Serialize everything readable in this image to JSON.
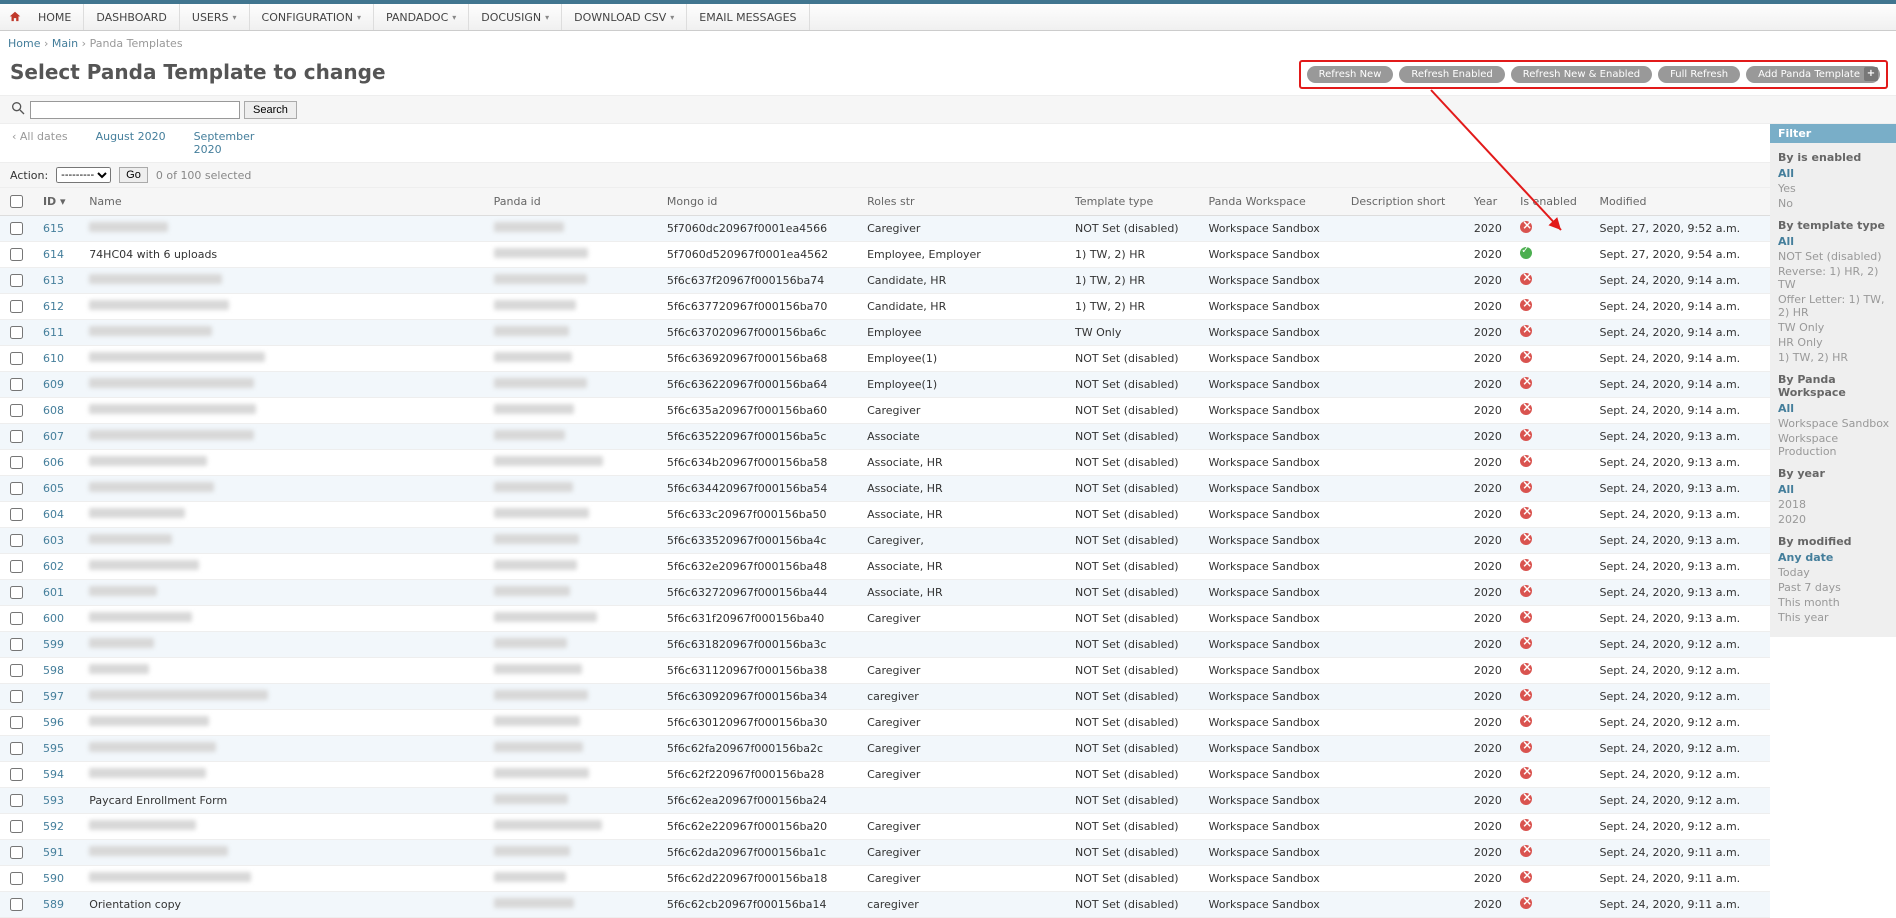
{
  "nav": {
    "items": [
      "HOME",
      "DASHBOARD",
      "USERS",
      "CONFIGURATION",
      "PANDADOC",
      "DOCUSIGN",
      "DOWNLOAD CSV",
      "EMAIL MESSAGES"
    ],
    "dropdown": [
      false,
      false,
      true,
      true,
      true,
      true,
      true,
      false
    ]
  },
  "breadcrumbs": {
    "home": "Home",
    "main": "Main",
    "current": "Panda Templates",
    "sep": "›"
  },
  "title": "Select Panda Template to change",
  "action_buttons": [
    "Refresh New",
    "Refresh Enabled",
    "Refresh New & Enabled",
    "Full Refresh",
    "Add Panda Template"
  ],
  "search": {
    "placeholder": "",
    "button": "Search"
  },
  "date_hierarchy": {
    "all": "‹ All dates",
    "m1": "August 2020",
    "m2": "September 2020"
  },
  "actions": {
    "label": "Action:",
    "placeholder": "---------",
    "go": "Go",
    "count": "0 of 100 selected"
  },
  "columns": [
    "",
    "ID",
    "Name",
    "Panda id",
    "Mongo id",
    "Roles str",
    "Template type",
    "Panda Workspace",
    "Description short",
    "Year",
    "Is enabled",
    "Modified"
  ],
  "rows": [
    {
      "id": "615",
      "name": "",
      "mongo": "5f7060dc20967f0001ea4566",
      "roles": "Caregiver",
      "ttype": "NOT Set (disabled)",
      "ws": "Workspace      Sandbox",
      "year": "2020",
      "enabled": false,
      "mod": "Sept. 27, 2020, 9:52 a.m."
    },
    {
      "id": "614",
      "name": "74HC04 with 6 uploads",
      "mongo": "5f7060d520967f0001ea4562",
      "roles": "Employee, Employer",
      "ttype": "1) TW, 2) HR",
      "ws": "Workspace      Sandbox",
      "year": "2020",
      "enabled": true,
      "mod": "Sept. 27, 2020, 9:54 a.m."
    },
    {
      "id": "613",
      "name": "",
      "mongo": "5f6c637f20967f000156ba74",
      "roles": "Candidate, HR",
      "ttype": "1) TW, 2) HR",
      "ws": "Workspace      Sandbox",
      "year": "2020",
      "enabled": false,
      "mod": "Sept. 24, 2020, 9:14 a.m."
    },
    {
      "id": "612",
      "name": "",
      "mongo": "5f6c637720967f000156ba70",
      "roles": "Candidate, HR",
      "ttype": "1) TW, 2) HR",
      "ws": "Workspace      Sandbox",
      "year": "2020",
      "enabled": false,
      "mod": "Sept. 24, 2020, 9:14 a.m."
    },
    {
      "id": "611",
      "name": "",
      "mongo": "5f6c637020967f000156ba6c",
      "roles": "Employee",
      "ttype": "TW Only",
      "ws": "Workspace      Sandbox",
      "year": "2020",
      "enabled": false,
      "mod": "Sept. 24, 2020, 9:14 a.m."
    },
    {
      "id": "610",
      "name": "",
      "mongo": "5f6c636920967f000156ba68",
      "roles": "Employee(1)",
      "ttype": "NOT Set (disabled)",
      "ws": "Workspace      Sandbox",
      "year": "2020",
      "enabled": false,
      "mod": "Sept. 24, 2020, 9:14 a.m."
    },
    {
      "id": "609",
      "name": "",
      "mongo": "5f6c636220967f000156ba64",
      "roles": "Employee(1)",
      "ttype": "NOT Set (disabled)",
      "ws": "Workspace      Sandbox",
      "year": "2020",
      "enabled": false,
      "mod": "Sept. 24, 2020, 9:14 a.m."
    },
    {
      "id": "608",
      "name": "",
      "mongo": "5f6c635a20967f000156ba60",
      "roles": "Caregiver",
      "ttype": "NOT Set (disabled)",
      "ws": "Workspace      Sandbox",
      "year": "2020",
      "enabled": false,
      "mod": "Sept. 24, 2020, 9:14 a.m."
    },
    {
      "id": "607",
      "name": "",
      "mongo": "5f6c635220967f000156ba5c",
      "roles": "        Associate",
      "ttype": "NOT Set (disabled)",
      "ws": "Workspace      Sandbox",
      "year": "2020",
      "enabled": false,
      "mod": "Sept. 24, 2020, 9:13 a.m."
    },
    {
      "id": "606",
      "name": "",
      "mongo": "5f6c634b20967f000156ba58",
      "roles": "        Associate, HR",
      "ttype": "NOT Set (disabled)",
      "ws": "Workspace      Sandbox",
      "year": "2020",
      "enabled": false,
      "mod": "Sept. 24, 2020, 9:13 a.m."
    },
    {
      "id": "605",
      "name": "",
      "mongo": "5f6c634420967f000156ba54",
      "roles": "        Associate, HR",
      "ttype": "NOT Set (disabled)",
      "ws": "Workspace      Sandbox",
      "year": "2020",
      "enabled": false,
      "mod": "Sept. 24, 2020, 9:13 a.m."
    },
    {
      "id": "604",
      "name": "",
      "mongo": "5f6c633c20967f000156ba50",
      "roles": "        Associate, HR",
      "ttype": "NOT Set (disabled)",
      "ws": "Workspace      Sandbox",
      "year": "2020",
      "enabled": false,
      "mod": "Sept. 24, 2020, 9:13 a.m."
    },
    {
      "id": "603",
      "name": "",
      "mongo": "5f6c633520967f000156ba4c",
      "roles": "Caregiver,",
      "ttype": "NOT Set (disabled)",
      "ws": "Workspace      Sandbox",
      "year": "2020",
      "enabled": false,
      "mod": "Sept. 24, 2020, 9:13 a.m."
    },
    {
      "id": "602",
      "name": "",
      "mongo": "5f6c632e20967f000156ba48",
      "roles": "        Associate, HR",
      "ttype": "NOT Set (disabled)",
      "ws": "Workspace      Sandbox",
      "year": "2020",
      "enabled": false,
      "mod": "Sept. 24, 2020, 9:13 a.m."
    },
    {
      "id": "601",
      "name": "",
      "mongo": "5f6c632720967f000156ba44",
      "roles": "        Associate, HR",
      "ttype": "NOT Set (disabled)",
      "ws": "Workspace      Sandbox",
      "year": "2020",
      "enabled": false,
      "mod": "Sept. 24, 2020, 9:13 a.m."
    },
    {
      "id": "600",
      "name": "",
      "mongo": "5f6c631f20967f000156ba40",
      "roles": "Caregiver",
      "ttype": "NOT Set (disabled)",
      "ws": "Workspace      Sandbox",
      "year": "2020",
      "enabled": false,
      "mod": "Sept. 24, 2020, 9:13 a.m."
    },
    {
      "id": "599",
      "name": "",
      "mongo": "5f6c631820967f000156ba3c",
      "roles": "",
      "ttype": "NOT Set (disabled)",
      "ws": "Workspace      Sandbox",
      "year": "2020",
      "enabled": false,
      "mod": "Sept. 24, 2020, 9:12 a.m."
    },
    {
      "id": "598",
      "name": "",
      "mongo": "5f6c631120967f000156ba38",
      "roles": "Caregiver",
      "ttype": "NOT Set (disabled)",
      "ws": "Workspace      Sandbox",
      "year": "2020",
      "enabled": false,
      "mod": "Sept. 24, 2020, 9:12 a.m."
    },
    {
      "id": "597",
      "name": "",
      "mongo": "5f6c630920967f000156ba34",
      "roles": "caregiver",
      "ttype": "NOT Set (disabled)",
      "ws": "Workspace      Sandbox",
      "year": "2020",
      "enabled": false,
      "mod": "Sept. 24, 2020, 9:12 a.m."
    },
    {
      "id": "596",
      "name": "",
      "mongo": "5f6c630120967f000156ba30",
      "roles": "Caregiver",
      "ttype": "NOT Set (disabled)",
      "ws": "Workspace      Sandbox",
      "year": "2020",
      "enabled": false,
      "mod": "Sept. 24, 2020, 9:12 a.m."
    },
    {
      "id": "595",
      "name": "",
      "mongo": "5f6c62fa20967f000156ba2c",
      "roles": "Caregiver",
      "ttype": "NOT Set (disabled)",
      "ws": "Workspace      Sandbox",
      "year": "2020",
      "enabled": false,
      "mod": "Sept. 24, 2020, 9:12 a.m."
    },
    {
      "id": "594",
      "name": "",
      "mongo": "5f6c62f220967f000156ba28",
      "roles": "Caregiver",
      "ttype": "NOT Set (disabled)",
      "ws": "Workspace      Sandbox",
      "year": "2020",
      "enabled": false,
      "mod": "Sept. 24, 2020, 9:12 a.m."
    },
    {
      "id": "593",
      "name": "Paycard Enrollment Form",
      "mongo": "5f6c62ea20967f000156ba24",
      "roles": "",
      "ttype": "NOT Set (disabled)",
      "ws": "Workspace      Sandbox",
      "year": "2020",
      "enabled": false,
      "mod": "Sept. 24, 2020, 9:12 a.m."
    },
    {
      "id": "592",
      "name": "",
      "mongo": "5f6c62e220967f000156ba20",
      "roles": "Caregiver",
      "ttype": "NOT Set (disabled)",
      "ws": "Workspace      Sandbox",
      "year": "2020",
      "enabled": false,
      "mod": "Sept. 24, 2020, 9:12 a.m."
    },
    {
      "id": "591",
      "name": "",
      "mongo": "5f6c62da20967f000156ba1c",
      "roles": "Caregiver",
      "ttype": "NOT Set (disabled)",
      "ws": "Workspace      Sandbox",
      "year": "2020",
      "enabled": false,
      "mod": "Sept. 24, 2020, 9:11 a.m."
    },
    {
      "id": "590",
      "name": "",
      "mongo": "5f6c62d220967f000156ba18",
      "roles": "Caregiver",
      "ttype": "NOT Set (disabled)",
      "ws": "Workspace      Sandbox",
      "year": "2020",
      "enabled": false,
      "mod": "Sept. 24, 2020, 9:11 a.m."
    },
    {
      "id": "589",
      "name": "Orientation copy",
      "mongo": "5f6c62cb20967f000156ba14",
      "roles": "caregiver",
      "ttype": "NOT Set (disabled)",
      "ws": "Workspace      Sandbox",
      "year": "2020",
      "enabled": false,
      "mod": "Sept. 24, 2020, 9:11 a.m."
    }
  ],
  "filter": {
    "header": "Filter",
    "groups": [
      {
        "title": "By is enabled",
        "items": [
          "All",
          "Yes",
          "No"
        ],
        "sel": 0
      },
      {
        "title": "By template type",
        "items": [
          "All",
          "NOT Set (disabled)",
          "Reverse: 1) HR, 2) TW",
          "Offer Letter: 1) TW, 2) HR",
          "TW Only",
          "HR Only",
          "1) TW, 2) HR"
        ],
        "sel": 0
      },
      {
        "title": "By Panda Workspace",
        "items": [
          "All",
          "Workspace      Sandbox",
          "Workspace      Production"
        ],
        "sel": 0
      },
      {
        "title": "By year",
        "items": [
          "All",
          "2018",
          "2020"
        ],
        "sel": 0
      },
      {
        "title": "By modified",
        "items": [
          "Any date",
          "Today",
          "Past 7 days",
          "This month",
          "This year"
        ],
        "sel": 0
      }
    ]
  }
}
